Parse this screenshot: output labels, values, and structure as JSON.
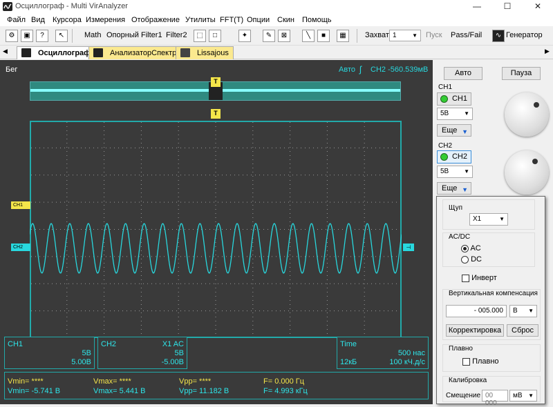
{
  "window": {
    "title": "Осциллограф - Multi VirAnalyzer",
    "minimize": "—",
    "maximize": "☐",
    "close": "✕"
  },
  "menu": [
    "Файл",
    "Вид",
    "Курсора",
    "Измерения",
    "Отображение",
    "Утилиты",
    "FFT(T)",
    "Опции",
    "Скин",
    "Помощь"
  ],
  "toolbar": {
    "math": "Math",
    "ref": "Опорный",
    "filter1": "Filter1",
    "filter2": "Filter2",
    "capture_label": "Захват",
    "capture_value": "1",
    "start": "Пуск",
    "passfail": "Pass/Fail",
    "generator": "Генератор"
  },
  "tabs": [
    "Осциллограф",
    "АнализаторСпектра",
    "Lissajous"
  ],
  "scope": {
    "status": "Бег",
    "trigger_mode": "Авто",
    "trigger_info": "CH2 -560.539мВ",
    "trigger_marker": "T",
    "ch1_marker": "CH1",
    "ch2_marker": "CH2",
    "ch1_box": {
      "title": "CH1",
      "scale": "5В",
      "offset": "5.00В"
    },
    "ch2_box": {
      "title": "CH2",
      "probe_coupling": "X1  AC",
      "scale": "5В",
      "offset": "-5.00В"
    },
    "time_box": {
      "title": "Time",
      "timebase": "500 нас",
      "buffer": "12кБ",
      "rate": "100 кЧ.д/с"
    },
    "measure": {
      "row1": [
        "Vmin= ****",
        "Vmax= ****",
        "Vpp= ****",
        "F= 0.000 Гц"
      ],
      "row2": [
        "Vmin= -5.741 В",
        "Vmax= 5.441 В",
        "Vpp= 11.182 В",
        "F= 4.993 кГц"
      ]
    },
    "signal_cycles": 20,
    "trace_color": "#28d8de"
  },
  "side": {
    "auto": "Авто",
    "pause": "Пауза",
    "ch1_label": "CH1",
    "ch1_button": "CH1",
    "ch1_scale": "5В",
    "ch1_more": "Еще",
    "ch2_label": "CH2",
    "ch2_button": "CH2",
    "ch2_scale": "5В",
    "ch2_more": "Еще"
  },
  "popup": {
    "probe_label": "Щуп",
    "probe_value": "X1",
    "acdc_label": "AC/DC",
    "ac": "AC",
    "dc": "DC",
    "invert": "Инверт",
    "vcomp_label": "Вертикальная компенсация",
    "vcomp_value": "- 005.000",
    "vcomp_unit": "В",
    "correct": "Корректировка",
    "reset": "Сброс",
    "smooth_label": "Плавно",
    "smooth_check": "Плавно",
    "calib_label": "Калибровка",
    "offset_label": "Смещение",
    "offset_value": "00 000",
    "offset_unit": "мВ"
  }
}
